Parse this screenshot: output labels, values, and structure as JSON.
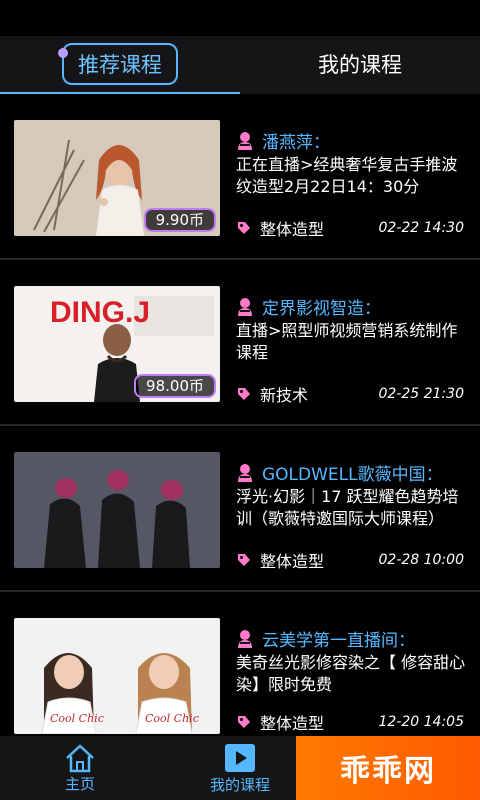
{
  "tabs": [
    {
      "label": "推荐课程",
      "active": true
    },
    {
      "label": "我的课程",
      "active": false
    }
  ],
  "courses": [
    {
      "author": "潘燕萍：",
      "title": "正在直播>经典奢华复古手推波纹造型2月22日14：30分",
      "price": "9.90币",
      "tag": "整体造型",
      "time": "02-22 14:30",
      "thumb": "woman-with-curly-hair-holding-dried-flowers"
    },
    {
      "author": "定界影视智造：",
      "title": "直播>照型师视频营销系统制作课程",
      "price": "98.00币",
      "tag": "新技术",
      "time": "02-25 21:30",
      "thumb": "DING.J",
      "thumb_text": "DING.J"
    },
    {
      "author": "GOLDWELL歌薇中国：",
      "title": "浮光·幻影｜17 跃型耀色趋势培训（歌薇特邀国际大师课程）",
      "tag": "整体造型",
      "time": "02-28 10:00",
      "thumb": "three-models-colored-hair"
    },
    {
      "author": "云美学第一直播间：",
      "title": "美奇丝光影修容染之【 修容甜心染】限时免费",
      "tag": "整体造型",
      "time": "12-20 14:05",
      "thumb": "two-women-white-shirts",
      "shirt_text": "Cool Chic"
    }
  ],
  "bottom_nav": [
    {
      "label": "主页",
      "icon": "home-icon"
    },
    {
      "label": "我的课程",
      "icon": "play-icon"
    }
  ],
  "watermark": "乖乖网",
  "colors": {
    "accent": "#55b8ff",
    "price_border": "#c27cff",
    "author_icon": "#ff7ac8",
    "watermark": "#ff6a00"
  }
}
